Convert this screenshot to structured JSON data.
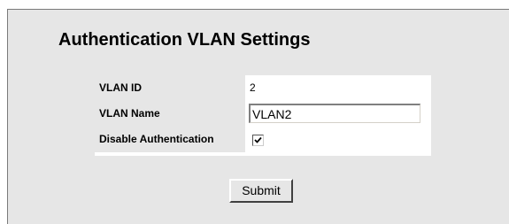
{
  "page": {
    "title": "Authentication VLAN Settings"
  },
  "form": {
    "vlan_id": {
      "label": "VLAN ID",
      "value": "2"
    },
    "vlan_name": {
      "label": "VLAN Name",
      "value": "VLAN2"
    },
    "disable_auth": {
      "label": "Disable Authentication",
      "checked": true
    },
    "submit_label": "Submit"
  },
  "colors": {
    "panel_background": "#e6e6e6",
    "table_background": "#ffffff"
  },
  "icons": {
    "checkbox_mark": "checkmark-icon"
  }
}
